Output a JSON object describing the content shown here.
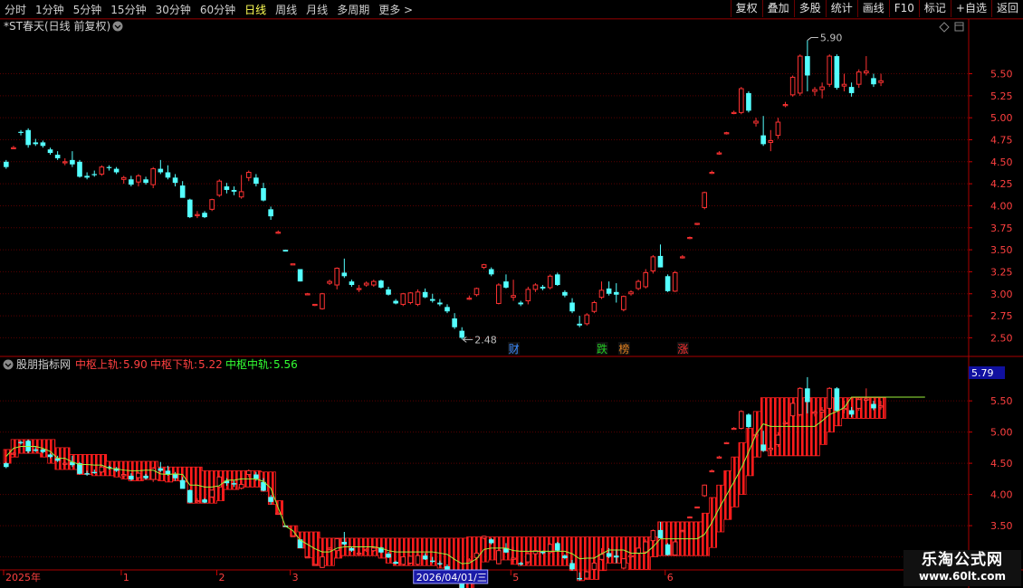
{
  "toolbar": {
    "periods": [
      "分时",
      "1分钟",
      "5分钟",
      "15分钟",
      "30分钟",
      "60分钟",
      "日线",
      "周线",
      "月线",
      "多周期",
      "更多"
    ],
    "active_index": 6,
    "more_arrow": ">",
    "buttons": [
      "复权",
      "叠加",
      "多股",
      "统计",
      "画线",
      "F10",
      "标记",
      "+自选",
      "返回"
    ]
  },
  "main_panel": {
    "title": "*ST春天(日线 前复权)",
    "high_label": "5.90",
    "low_label": "2.48",
    "event_markers": [
      {
        "label": "财",
        "color": "#3c8cff",
        "index": 69
      },
      {
        "label": "跌",
        "color": "#22cc22",
        "index": 81
      },
      {
        "label": "榜",
        "color": "#e08020",
        "index": 84
      },
      {
        "label": "涨",
        "color": "#ff3030",
        "index": 92
      }
    ]
  },
  "indicator_panel": {
    "title": "股朋指标网",
    "upper_label": "中枢上轨:",
    "upper_value": "5.90",
    "lower_label": "中枢下轨:",
    "lower_value": "5.22",
    "mid_label": "中枢中轨:",
    "mid_value": "5.56",
    "price_tag": "5.79"
  },
  "date_axis": {
    "labels": [
      {
        "text": "2025年",
        "index": 0
      },
      {
        "text": "1",
        "index": 16
      },
      {
        "text": "2",
        "index": 29
      },
      {
        "text": "3",
        "index": 39
      },
      {
        "text": "5",
        "index": 69
      },
      {
        "text": "6",
        "index": 90
      }
    ],
    "cursor_label": "2026/04/01/三",
    "cursor_index": 56
  },
  "watermark": {
    "line1": "乐淘公式网",
    "line2": "www.60lt.com"
  },
  "chart_data": {
    "type": "candlestick",
    "title": "*ST春天(日线 前复权)",
    "price_axis_main": {
      "range": [
        2.35,
        6.05
      ],
      "ticks": [
        2.5,
        2.75,
        3.0,
        3.25,
        3.5,
        3.75,
        4.0,
        4.25,
        4.5,
        4.75,
        5.0,
        5.25,
        5.5
      ]
    },
    "price_axis_indicator": {
      "range": [
        2.82,
        5.98
      ],
      "ticks": [
        3.0,
        3.5,
        4.0,
        4.5,
        5.0,
        5.5
      ]
    },
    "up_color": "#ff3232",
    "down_color": "#54ffff",
    "ohlc": [
      [
        4.5,
        4.52,
        4.42,
        4.44
      ],
      [
        4.66,
        4.68,
        4.65,
        4.66
      ],
      [
        4.84,
        4.86,
        4.8,
        4.83
      ],
      [
        4.86,
        4.88,
        4.66,
        4.69
      ],
      [
        4.72,
        4.76,
        4.68,
        4.7
      ],
      [
        4.72,
        4.74,
        4.66,
        4.68
      ],
      [
        4.64,
        4.66,
        4.58,
        4.6
      ],
      [
        4.58,
        4.62,
        4.52,
        4.54
      ],
      [
        4.5,
        4.54,
        4.46,
        4.5
      ],
      [
        4.52,
        4.62,
        4.44,
        4.47
      ],
      [
        4.5,
        4.52,
        4.32,
        4.33
      ],
      [
        4.34,
        4.38,
        4.3,
        4.32
      ],
      [
        4.36,
        4.4,
        4.33,
        4.35
      ],
      [
        4.36,
        4.46,
        4.34,
        4.44
      ],
      [
        4.44,
        4.46,
        4.4,
        4.43
      ],
      [
        4.42,
        4.44,
        4.36,
        4.38
      ],
      [
        4.3,
        4.34,
        4.25,
        4.32
      ],
      [
        4.3,
        4.34,
        4.22,
        4.24
      ],
      [
        4.27,
        4.36,
        4.22,
        4.34
      ],
      [
        4.3,
        4.33,
        4.24,
        4.26
      ],
      [
        4.24,
        4.44,
        4.2,
        4.42
      ],
      [
        4.42,
        4.52,
        4.36,
        4.38
      ],
      [
        4.38,
        4.46,
        4.3,
        4.32
      ],
      [
        4.32,
        4.36,
        4.22,
        4.26
      ],
      [
        4.23,
        4.28,
        4.1,
        4.09
      ],
      [
        4.07,
        4.08,
        3.86,
        3.87
      ],
      [
        3.9,
        3.94,
        3.86,
        3.9
      ],
      [
        3.92,
        3.94,
        3.86,
        3.87
      ],
      [
        3.96,
        4.08,
        3.94,
        4.07
      ],
      [
        4.12,
        4.3,
        4.1,
        4.28
      ],
      [
        4.22,
        4.26,
        4.14,
        4.18
      ],
      [
        4.18,
        4.22,
        4.12,
        4.16
      ],
      [
        4.1,
        4.35,
        4.08,
        4.16
      ],
      [
        4.32,
        4.4,
        4.28,
        4.38
      ],
      [
        4.32,
        4.36,
        4.22,
        4.25
      ],
      [
        4.2,
        4.26,
        4.05,
        4.06
      ],
      [
        3.96,
        3.99,
        3.84,
        3.88
      ],
      [
        3.7,
        3.72,
        3.68,
        3.7
      ],
      [
        3.5,
        3.5,
        3.48,
        3.48
      ],
      [
        3.34,
        3.34,
        3.33,
        3.34
      ],
      [
        3.28,
        3.28,
        3.14,
        3.14
      ],
      [
        3.0,
        3.01,
        2.99,
        3.0
      ],
      [
        2.88,
        2.88,
        2.86,
        2.88
      ],
      [
        2.83,
        3.01,
        2.82,
        3.0
      ],
      [
        3.12,
        3.16,
        3.1,
        3.14
      ],
      [
        3.1,
        3.3,
        3.05,
        3.29
      ],
      [
        3.24,
        3.4,
        3.18,
        3.2
      ],
      [
        3.14,
        3.16,
        3.08,
        3.1
      ],
      [
        3.05,
        3.1,
        3.02,
        3.06
      ],
      [
        3.1,
        3.14,
        3.08,
        3.12
      ],
      [
        3.1,
        3.16,
        3.08,
        3.14
      ],
      [
        3.15,
        3.16,
        3.06,
        3.07
      ],
      [
        3.05,
        3.08,
        2.98,
        2.99
      ],
      [
        2.92,
        2.94,
        2.88,
        2.89
      ],
      [
        2.88,
        3.01,
        2.86,
        3.0
      ],
      [
        2.9,
        3.02,
        2.88,
        3.01
      ],
      [
        2.88,
        3.05,
        2.86,
        3.02
      ],
      [
        3.02,
        3.06,
        2.95,
        2.96
      ],
      [
        2.94,
        3.0,
        2.9,
        2.92
      ],
      [
        2.9,
        2.94,
        2.86,
        2.88
      ],
      [
        2.85,
        2.88,
        2.78,
        2.8
      ],
      [
        2.72,
        2.78,
        2.6,
        2.62
      ],
      [
        2.58,
        2.62,
        2.48,
        2.5
      ],
      [
        2.95,
        2.98,
        2.93,
        2.95
      ],
      [
        2.99,
        3.07,
        2.97,
        3.06
      ],
      [
        3.3,
        3.34,
        3.28,
        3.33
      ],
      [
        3.28,
        3.3,
        3.2,
        3.22
      ],
      [
        2.89,
        3.12,
        2.88,
        3.1
      ],
      [
        3.14,
        3.22,
        3.06,
        3.07
      ],
      [
        2.96,
        3.16,
        2.92,
        2.98
      ],
      [
        2.9,
        2.92,
        2.86,
        2.88
      ],
      [
        2.92,
        3.08,
        2.88,
        3.05
      ],
      [
        3.05,
        3.12,
        3.02,
        3.1
      ],
      [
        3.08,
        3.1,
        3.04,
        3.06
      ],
      [
        3.07,
        3.22,
        3.05,
        3.2
      ],
      [
        3.22,
        3.24,
        3.09,
        3.1
      ],
      [
        3.02,
        3.04,
        2.96,
        2.98
      ],
      [
        2.9,
        2.95,
        2.78,
        2.8
      ],
      [
        2.66,
        2.75,
        2.62,
        2.64
      ],
      [
        2.66,
        2.78,
        2.64,
        2.76
      ],
      [
        2.8,
        2.92,
        2.78,
        2.9
      ],
      [
        2.96,
        3.14,
        2.94,
        3.04
      ],
      [
        3.06,
        3.14,
        2.98,
        3.0
      ],
      [
        3.02,
        3.12,
        2.9,
        2.99
      ],
      [
        2.82,
        2.98,
        2.8,
        2.97
      ],
      [
        3.0,
        3.04,
        2.98,
        3.02
      ],
      [
        3.06,
        3.16,
        3.04,
        3.14
      ],
      [
        3.08,
        3.28,
        3.06,
        3.24
      ],
      [
        3.26,
        3.44,
        3.23,
        3.42
      ],
      [
        3.43,
        3.56,
        3.3,
        3.3
      ],
      [
        3.2,
        3.22,
        3.02,
        3.03
      ],
      [
        3.03,
        3.26,
        3.02,
        3.24
      ],
      [
        3.42,
        3.44,
        3.4,
        3.42
      ],
      [
        3.64,
        3.65,
        3.62,
        3.64
      ],
      [
        3.8,
        3.8,
        3.78,
        3.8
      ],
      [
        3.98,
        4.16,
        3.96,
        4.15
      ],
      [
        4.38,
        4.4,
        4.36,
        4.38
      ],
      [
        4.6,
        4.62,
        4.58,
        4.6
      ],
      [
        4.83,
        4.84,
        4.81,
        4.83
      ],
      [
        5.06,
        5.08,
        5.04,
        5.06
      ],
      [
        5.06,
        5.35,
        5.04,
        5.33
      ],
      [
        5.28,
        5.3,
        5.06,
        5.08
      ],
      [
        4.94,
        5.0,
        4.9,
        4.96
      ],
      [
        4.8,
        5.02,
        4.68,
        4.7
      ],
      [
        4.72,
        4.86,
        4.62,
        4.74
      ],
      [
        4.8,
        5.0,
        4.76,
        4.95
      ],
      [
        5.14,
        5.18,
        5.12,
        5.15
      ],
      [
        5.26,
        5.48,
        5.24,
        5.46
      ],
      [
        5.28,
        5.72,
        5.25,
        5.7
      ],
      [
        5.7,
        5.88,
        5.3,
        5.48
      ],
      [
        5.3,
        5.35,
        5.25,
        5.32
      ],
      [
        5.32,
        5.4,
        5.22,
        5.35
      ],
      [
        5.38,
        5.72,
        5.35,
        5.7
      ],
      [
        5.7,
        5.72,
        5.32,
        5.34
      ],
      [
        5.36,
        5.5,
        5.3,
        5.38
      ],
      [
        5.35,
        5.4,
        5.24,
        5.28
      ],
      [
        5.38,
        5.55,
        5.34,
        5.52
      ],
      [
        5.51,
        5.7,
        5.48,
        5.53
      ],
      [
        5.45,
        5.5,
        5.35,
        5.38
      ],
      [
        5.4,
        5.5,
        5.36,
        5.42
      ]
    ],
    "indicator_lines": {
      "upper": [
        4.72,
        4.88,
        4.88,
        4.88,
        4.88,
        4.88,
        4.88,
        4.75,
        4.75,
        4.64,
        4.64,
        4.64,
        4.64,
        4.64,
        4.53,
        4.53,
        4.53,
        4.53,
        4.53,
        4.53,
        4.53,
        4.44,
        4.44,
        4.44,
        4.44,
        4.44,
        4.44,
        4.38,
        4.38,
        4.38,
        4.38,
        4.38,
        4.38,
        4.38,
        4.38,
        4.36,
        4.36,
        3.9,
        3.5,
        3.5,
        3.4,
        3.4,
        3.4,
        3.3,
        3.3,
        3.3,
        3.3,
        3.3,
        3.3,
        3.3,
        3.3,
        3.3,
        3.3,
        3.3,
        3.3,
        3.3,
        3.3,
        3.3,
        3.3,
        3.3,
        3.3,
        3.3,
        3.3,
        3.32,
        3.32,
        3.32,
        3.32,
        3.32,
        3.32,
        3.32,
        3.32,
        3.32,
        3.32,
        3.32,
        3.32,
        3.32,
        3.32,
        3.32,
        3.32,
        3.32,
        3.32,
        3.32,
        3.32,
        3.32,
        3.32,
        3.32,
        3.32,
        3.32,
        3.32,
        3.56,
        3.56,
        3.56,
        3.56,
        3.56,
        3.56,
        3.7,
        3.95,
        4.15,
        4.38,
        4.6,
        4.83,
        5.06,
        5.33,
        5.55,
        5.55,
        5.55,
        5.55,
        5.55,
        5.55,
        5.55,
        5.55,
        5.55,
        5.55,
        5.55,
        5.55,
        5.55,
        5.55,
        5.55,
        5.55,
        5.55,
        5.9,
        5.9,
        5.9,
        5.9,
        5.9,
        5.9,
        5.9,
        5.9,
        5.9,
        5.9,
        5.9
      ],
      "lower": [
        4.5,
        4.6,
        4.66,
        4.66,
        4.66,
        4.6,
        4.5,
        4.4,
        4.4,
        4.4,
        4.32,
        4.32,
        4.3,
        4.3,
        4.3,
        4.28,
        4.25,
        4.22,
        4.22,
        4.24,
        4.24,
        4.22,
        4.2,
        4.22,
        4.2,
        3.86,
        3.86,
        3.86,
        3.86,
        3.9,
        4.08,
        4.08,
        4.12,
        4.12,
        4.12,
        4.05,
        3.84,
        3.68,
        3.48,
        3.33,
        3.14,
        2.99,
        2.86,
        2.86,
        2.86,
        2.98,
        3.02,
        3.02,
        3.02,
        3.02,
        3.02,
        2.98,
        2.9,
        2.86,
        2.86,
        2.86,
        2.86,
        2.86,
        2.86,
        2.82,
        2.78,
        2.62,
        2.48,
        2.48,
        2.62,
        2.92,
        2.95,
        2.95,
        2.95,
        2.88,
        2.86,
        2.86,
        2.86,
        2.86,
        2.86,
        2.86,
        2.86,
        2.78,
        2.62,
        2.64,
        2.64,
        2.78,
        2.9,
        2.9,
        2.9,
        2.8,
        2.8,
        2.8,
        3.0,
        3.02,
        3.02,
        3.02,
        3.02,
        3.02,
        3.02,
        3.02,
        3.15,
        3.4,
        3.6,
        3.8,
        4.0,
        4.3,
        4.6,
        4.7,
        4.62,
        4.62,
        4.62,
        4.62,
        4.62,
        4.62,
        4.62,
        4.8,
        5.0,
        5.1,
        5.22,
        5.22,
        5.22,
        5.22,
        5.22,
        5.22,
        5.22,
        5.22,
        5.22,
        5.22,
        5.22,
        5.22
      ],
      "mid": [
        4.61,
        4.74,
        4.77,
        4.77,
        4.77,
        4.74,
        4.69,
        4.58,
        4.58,
        4.52,
        4.48,
        4.48,
        4.47,
        4.47,
        4.42,
        4.41,
        4.39,
        4.38,
        4.38,
        4.39,
        4.39,
        4.33,
        4.32,
        4.33,
        4.32,
        4.15,
        4.15,
        4.12,
        4.12,
        4.14,
        4.23,
        4.23,
        4.25,
        4.25,
        4.25,
        4.21,
        4.1,
        3.79,
        3.49,
        3.42,
        3.27,
        3.2,
        3.13,
        3.08,
        3.08,
        3.14,
        3.16,
        3.16,
        3.16,
        3.16,
        3.16,
        3.14,
        3.1,
        3.08,
        3.08,
        3.08,
        3.08,
        3.08,
        3.08,
        3.06,
        3.04,
        2.96,
        2.89,
        2.9,
        2.97,
        3.12,
        3.14,
        3.14,
        3.14,
        3.1,
        3.09,
        3.09,
        3.09,
        3.09,
        3.09,
        3.09,
        3.09,
        3.05,
        2.97,
        2.98,
        2.98,
        3.05,
        3.11,
        3.11,
        3.11,
        3.06,
        3.06,
        3.06,
        3.16,
        3.29,
        3.29,
        3.29,
        3.29,
        3.29,
        3.29,
        3.36,
        3.55,
        3.78,
        3.99,
        4.2,
        4.42,
        4.68,
        4.96,
        5.13,
        5.09,
        5.09,
        5.09,
        5.09,
        5.09,
        5.09,
        5.09,
        5.18,
        5.28,
        5.33,
        5.39,
        5.56,
        5.56,
        5.56,
        5.56,
        5.56,
        5.56,
        5.56,
        5.56,
        5.56,
        5.56,
        5.56
      ]
    }
  }
}
